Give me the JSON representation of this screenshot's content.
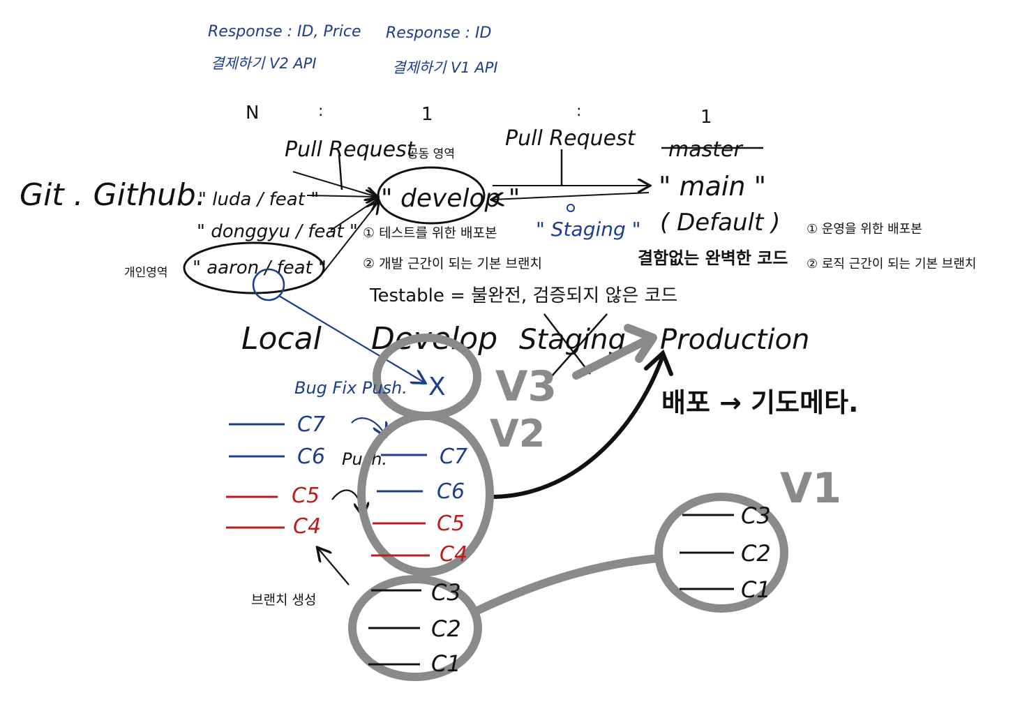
{
  "colors": {
    "ink": "#111111",
    "blue": "#1a3e8c",
    "red": "#b81e1e",
    "gray": "#8a8a8a",
    "background": "#ffffff"
  },
  "api_notes": {
    "v2_response": "Response : ID, Price",
    "v2_api": "결제하기 V2 API",
    "v1_response": "Response : ID",
    "v1_api": "결제하기 V1 API"
  },
  "ratio": {
    "n": "N",
    "colon1": ":",
    "one1": "1",
    "colon2": ":",
    "one2": "1"
  },
  "flow": {
    "title": "Git . Github.",
    "pr_left": "Pull Request",
    "pr_right": "Pull Request",
    "common_area": "공동 영역",
    "personal_area": "개인영역",
    "branches": [
      "\" luda / feat \"",
      "\" donggyu / feat \"",
      "\" aaron / feat \""
    ],
    "develop": "\" develop \"",
    "develop_notes": [
      "① 테스트를 위한 배포본",
      "② 개발 근간이 되는 기본 브랜치"
    ],
    "staging": "\" Staging \"",
    "master_struck": "master",
    "main": "\" main \"",
    "default": "( Default )",
    "main_desc": "결함없는 완벽한 코드",
    "main_notes": [
      "① 운영을 위한 배포본",
      "② 로직 근간이 되는 기본 브랜치"
    ],
    "testable": "Testable = 불완전, 검증되지 않은 코드"
  },
  "stages": {
    "local": "Local",
    "develop": "Develop",
    "staging": "Staging",
    "production": "Production"
  },
  "versions": {
    "v3": "V3",
    "v2": "V2",
    "v1": "V1"
  },
  "commits": {
    "bugfix": "Bug Fix Push.",
    "x_mark": "X",
    "push": "Push.",
    "branch_create": "브랜치 생성",
    "deploy_wait": "배포 → 기도메타.",
    "local_list": [
      "C7",
      "C6",
      "C5",
      "C4"
    ],
    "develop_list": [
      "C7",
      "C6",
      "C5",
      "C4"
    ],
    "base_list": [
      "C3",
      "C2",
      "C1"
    ],
    "prod_list": [
      "C3",
      "C2",
      "C1"
    ]
  }
}
